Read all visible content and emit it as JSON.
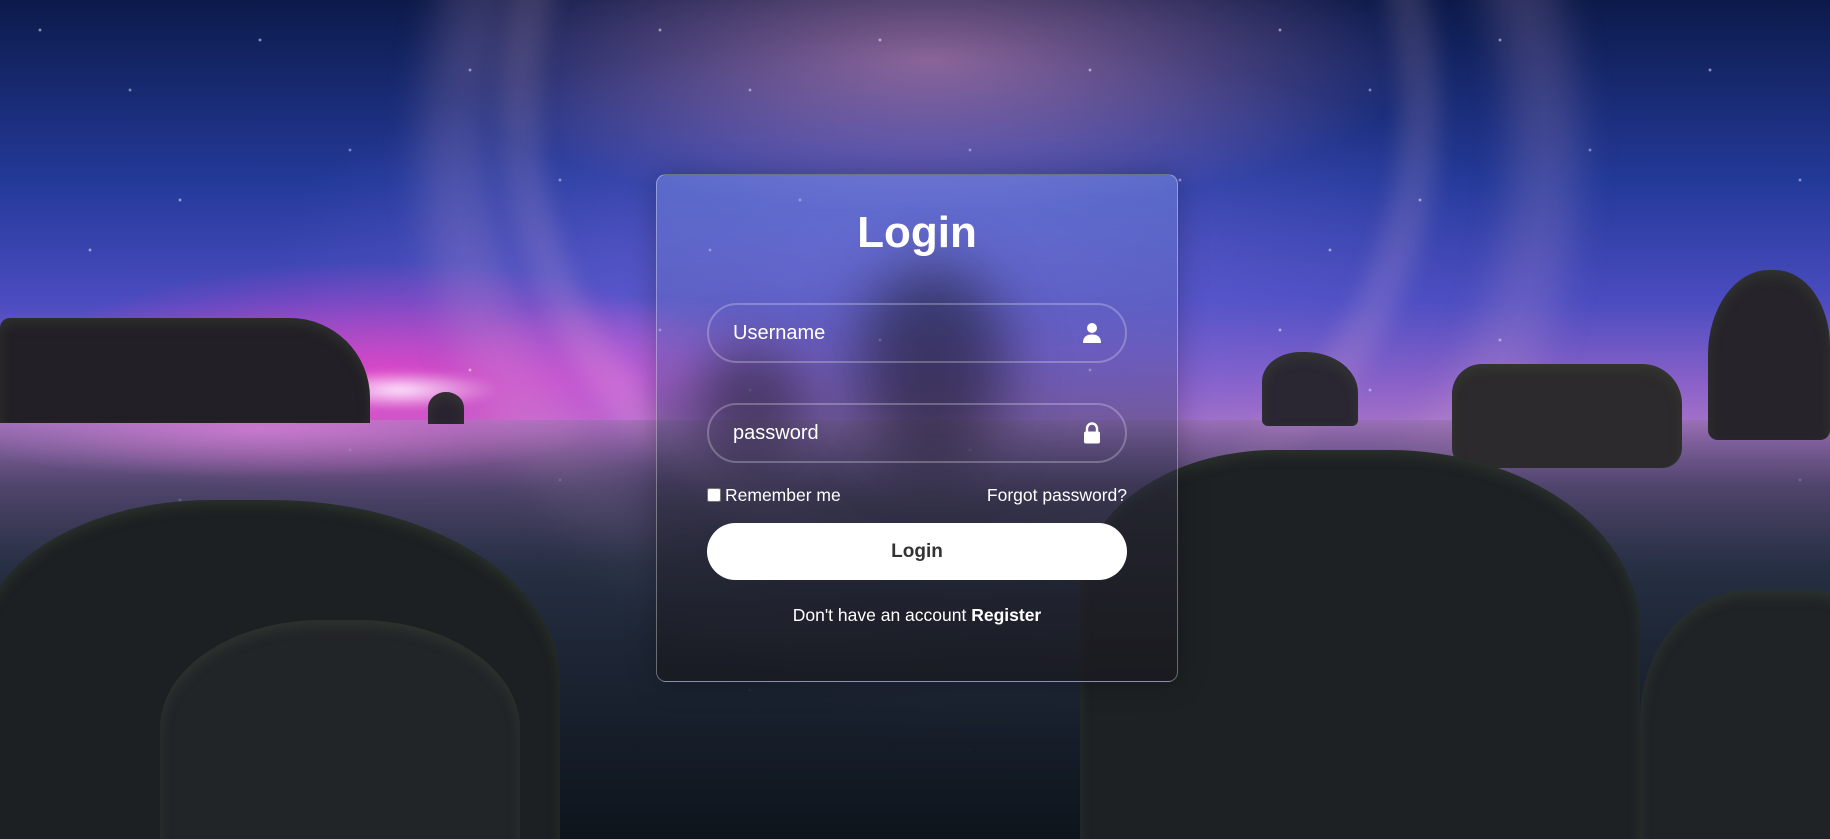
{
  "login": {
    "title": "Login",
    "username": {
      "placeholder": "Username",
      "icon": "user-icon"
    },
    "password": {
      "placeholder": "password",
      "icon": "lock-icon"
    },
    "remember_label": "Remember me",
    "forgot_label": "Forgot password?",
    "submit_label": "Login",
    "register_prompt": "Don't have an account",
    "register_label": "Register"
  }
}
